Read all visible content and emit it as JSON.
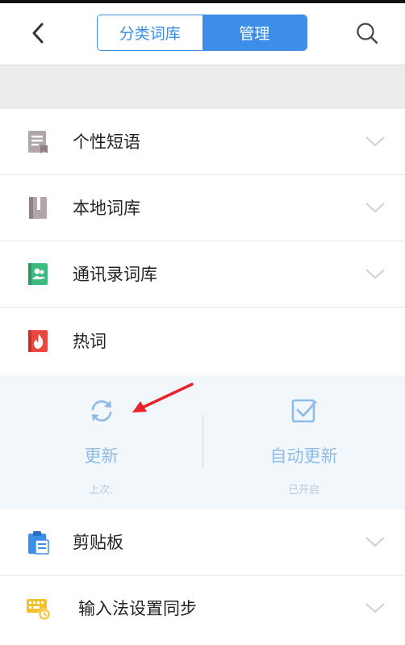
{
  "header": {
    "tabs": [
      {
        "label": "分类词库",
        "active": false
      },
      {
        "label": "管理",
        "active": true
      }
    ]
  },
  "rows": [
    {
      "label": "个性短语",
      "icon": "phrase-doc-icon"
    },
    {
      "label": "本地词库",
      "icon": "book-icon"
    },
    {
      "label": "通讯录词库",
      "icon": "contacts-book-icon"
    },
    {
      "label": "热词",
      "icon": "flame-icon"
    },
    {
      "label": "剪贴板",
      "icon": "clipboard-icon"
    },
    {
      "label": "输入法设置同步",
      "icon": "keyboard-sync-icon"
    }
  ],
  "hotwords": {
    "update": {
      "title": "更新",
      "sub": "上次:"
    },
    "auto_update": {
      "title": "自动更新",
      "sub": "已开启"
    }
  },
  "colors": {
    "accent": "#3d8ee8",
    "panel_bg": "#f2f7fc",
    "annotation_arrow": "#e8232a"
  }
}
